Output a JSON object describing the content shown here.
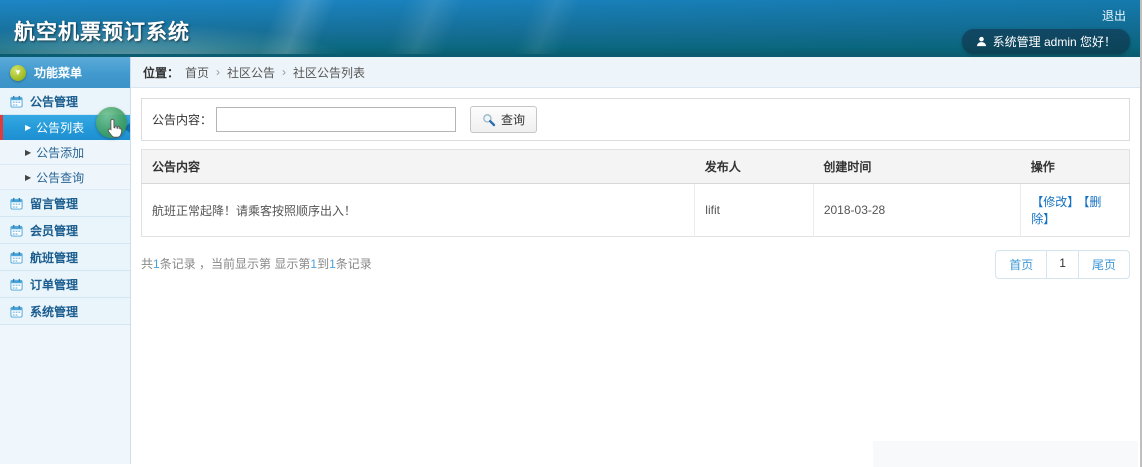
{
  "header": {
    "title": "航空机票预订系统",
    "logout_label": "退出",
    "user_greeting": "系统管理 admin 您好！"
  },
  "sidebar": {
    "menu_title": "功能菜单",
    "items": [
      {
        "label": "公告管理",
        "type": "group"
      },
      {
        "label": "公告列表",
        "type": "sub",
        "selected": true
      },
      {
        "label": "公告添加",
        "type": "sub"
      },
      {
        "label": "公告查询",
        "type": "sub"
      },
      {
        "label": "留言管理",
        "type": "group"
      },
      {
        "label": "会员管理",
        "type": "group"
      },
      {
        "label": "航班管理",
        "type": "group"
      },
      {
        "label": "订单管理",
        "type": "group"
      },
      {
        "label": "系统管理",
        "type": "group"
      }
    ]
  },
  "breadcrumb": {
    "prefix": "位置：",
    "separator": "›",
    "items": [
      "首页",
      "社区公告",
      "社区公告列表"
    ]
  },
  "search": {
    "label": "公告内容：",
    "input_value": "",
    "button_label": "查询"
  },
  "table": {
    "columns": [
      "公告内容",
      "发布人",
      "创建时间",
      "操作"
    ],
    "rows": [
      {
        "content": "航班正常起降！请乘客按照顺序出入！",
        "publisher": "lifit",
        "created": "2018-03-28",
        "actions": [
          "【修改】",
          "【删除】"
        ]
      }
    ]
  },
  "pagination": {
    "summary_parts": [
      "共",
      "1",
      "条记录 ，当前显示第  显示第",
      "1",
      "到",
      "1",
      "条记录"
    ],
    "first_label": "首页",
    "current_page": "1",
    "last_label": "尾页"
  },
  "colors": {
    "accent_blue": "#2ba0dd",
    "selected_stripe_red": "#e23b3b",
    "link_blue": "#1472c4",
    "header_teal": "#0c6a80"
  }
}
